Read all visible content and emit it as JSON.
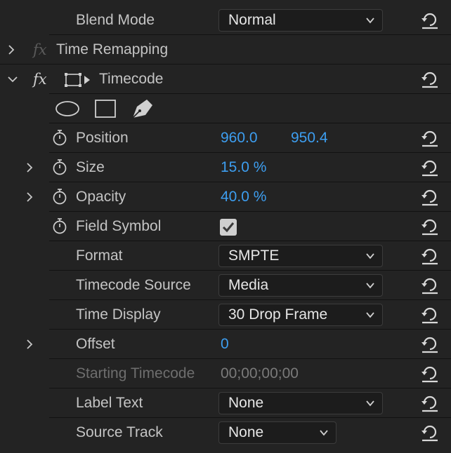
{
  "panel": {
    "blend_mode": {
      "label": "Blend Mode",
      "value": "Normal"
    },
    "time_remapping": {
      "fx": "fx",
      "label": "Time Remapping"
    },
    "timecode": {
      "fx": "fx",
      "label": "Timecode"
    },
    "mask_tools": [
      "ellipse-mask-tool",
      "rectangle-mask-tool",
      "pen-mask-tool"
    ],
    "position": {
      "label": "Position",
      "x": "960.0",
      "y": "950.4"
    },
    "size": {
      "label": "Size",
      "value": "15.0 %"
    },
    "opacity": {
      "label": "Opacity",
      "value": "40.0 %"
    },
    "field_symbol": {
      "label": "Field Symbol",
      "checked": true
    },
    "format": {
      "label": "Format",
      "value": "SMPTE"
    },
    "timecode_source": {
      "label": "Timecode Source",
      "value": "Media"
    },
    "time_display": {
      "label": "Time Display",
      "value": "30 Drop Frame"
    },
    "offset": {
      "label": "Offset",
      "value": "0"
    },
    "starting_timecode": {
      "label": "Starting Timecode",
      "value": "00;00;00;00"
    },
    "label_text": {
      "label": "Label Text",
      "value": "None"
    },
    "source_track": {
      "label": "Source Track",
      "value": "None"
    }
  },
  "colors": {
    "background": "#232323",
    "accent_value": "#3d9ef0",
    "label": "#c4c4c4",
    "disabled": "#6e6e6e"
  }
}
